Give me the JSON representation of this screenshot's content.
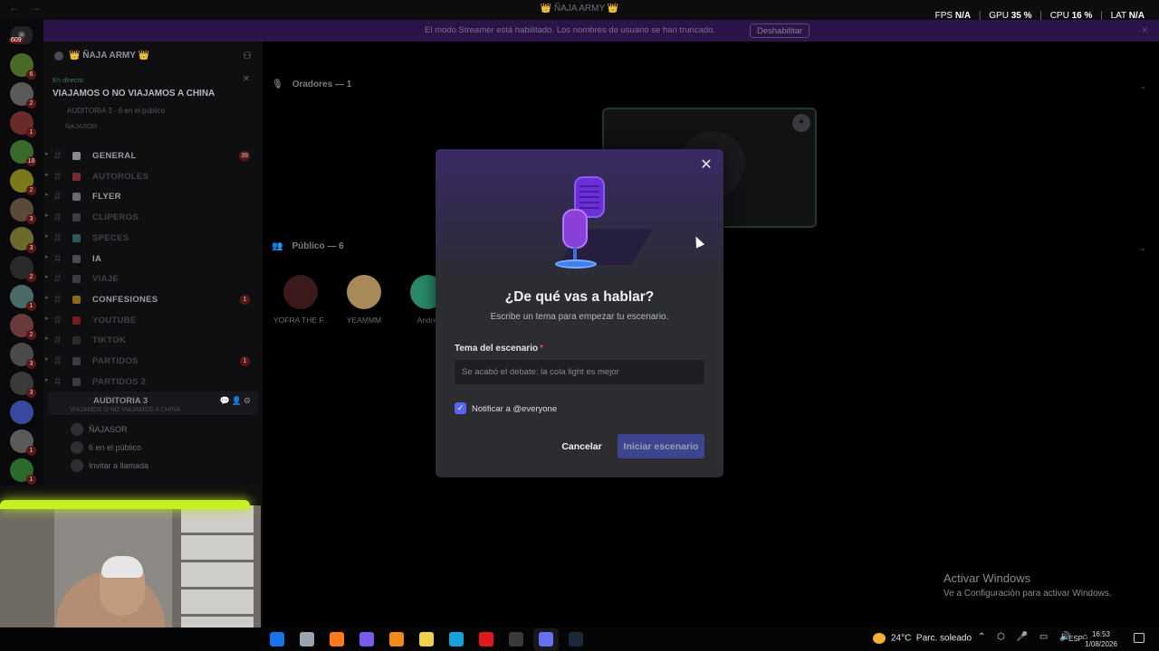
{
  "titlebar": {
    "nav_back": "←",
    "nav_forward": "→",
    "title": "👑 ÑAJA ARMY 👑",
    "stats": {
      "fps_label": "FPS",
      "fps_value": "N/A",
      "gpu_label": "GPU",
      "gpu_value": "35 %",
      "cpu_label": "CPU",
      "cpu_value": "16 %",
      "lat_label": "LAT",
      "lat_value": "N/A"
    }
  },
  "banner": {
    "message": "El modo Streamer está habilitado. Los nombres de usuario se han truncado.",
    "button": "Deshabilitar",
    "close": "×"
  },
  "rail": {
    "count": "609",
    "servers": [
      {
        "badge": "6",
        "color": "#4a6a2a"
      },
      {
        "badge": "2",
        "color": "#5a5a5a"
      },
      {
        "badge": "1",
        "color": "#6a2a2a"
      },
      {
        "badge": "18",
        "color": "#3a6a2a"
      },
      {
        "badge": "2",
        "color": "#7a7a1a"
      },
      {
        "badge": "3",
        "color": "#5a4a3a"
      },
      {
        "badge": "3",
        "color": "#6a6a2a"
      },
      {
        "badge": "2",
        "color": "#2a2a2a"
      },
      {
        "badge": "1",
        "color": "#4a6a6a"
      },
      {
        "badge": "2",
        "color": "#6a3a3a"
      },
      {
        "badge": "3",
        "color": "#4a4a4a"
      },
      {
        "badge": "3",
        "color": "#3a3a3a"
      },
      {
        "badge": "",
        "color": "#3a4aa0"
      },
      {
        "badge": "1",
        "color": "#5a5a5a"
      },
      {
        "badge": "1",
        "color": "#2a6a2a"
      }
    ]
  },
  "sidebar": {
    "server_name": "👑 ÑAJA ARMY 👑",
    "live_tag": "En directo",
    "live_title": "VIAJAMOS O NO VIAJAMOS A CHINA",
    "live_sub": "AUDITORIA 3  ·  6 en el público",
    "live_sub2": "ÑAJASOR",
    "channels": [
      {
        "label": "GENERAL",
        "badge": "39",
        "bright": true,
        "color": "#8a8c91"
      },
      {
        "label": "AUTOROLES",
        "badge": "",
        "bright": false,
        "color": "#7a2a2a"
      },
      {
        "label": "FLYER",
        "badge": "",
        "bright": true,
        "color": "#6a6c72"
      },
      {
        "label": "CLIPEROS",
        "badge": "",
        "bright": false,
        "color": "#3a3c42"
      },
      {
        "label": "SPECES",
        "badge": "",
        "bright": false,
        "color": "#2a5a5a"
      },
      {
        "label": "IA",
        "badge": "",
        "bright": true,
        "color": "#4a4c52"
      },
      {
        "label": "VIAJE",
        "badge": "",
        "bright": false,
        "color": "#3a3c42"
      },
      {
        "label": "CONFESIONES",
        "badge": "1",
        "bright": true,
        "color": "#8a6a1a"
      },
      {
        "label": "YOUTUBE",
        "badge": "",
        "bright": false,
        "color": "#7a1a1a"
      },
      {
        "label": "TIKTOK",
        "badge": "",
        "bright": false,
        "color": "#2a2a2a"
      },
      {
        "label": "PARTIDOS",
        "badge": "1",
        "bright": false,
        "color": "#3a3c42"
      },
      {
        "label": "PARTIDOS 2",
        "badge": "",
        "bright": false,
        "color": "#3a3c42"
      }
    ],
    "voice": {
      "label": "AUDITORIA 3",
      "sub": "VIAJAMOS O NO VIAJAMOS A CHINA",
      "icons": "💬👤⚙"
    },
    "voice_members": [
      {
        "label": "ÑAJASOR"
      },
      {
        "label": "6 en el público"
      },
      {
        "label": "Invitar a llamada"
      }
    ]
  },
  "stage": {
    "speakers_title": "Oradores — 1",
    "audience_title": "Público — 6",
    "audience": [
      {
        "name": "YOFRA THE F...",
        "color": "#3a1a1a"
      },
      {
        "name": "YEAMMM",
        "color": "#a88a5a"
      },
      {
        "name": "Andre",
        "color": "#2a8a6a"
      }
    ],
    "watermark_title": "Activar Windows",
    "watermark_sub": "Ve a Configuración para activar Windows."
  },
  "modal": {
    "close": "✕",
    "heading": "¿De qué vas a hablar?",
    "subheading": "Escribe un tema para empezar tu escenario.",
    "field_label": "Tema del escenario",
    "field_required": "*",
    "field_value": "",
    "field_placeholder": "Se acabó el debate: la cola light es mejor",
    "checkbox_checked": true,
    "checkbox_label": "Notificar a @everyone",
    "cancel": "Cancelar",
    "start": "Iniciar escenario"
  },
  "taskbar": {
    "apps": [
      {
        "name": "outlook",
        "color": "#1a73e8",
        "active": false
      },
      {
        "name": "files",
        "color": "#9aa3b0",
        "active": false
      },
      {
        "name": "firefox",
        "color": "#ff7a1a",
        "active": false
      },
      {
        "name": "copilot",
        "color": "#7a5af0",
        "active": false
      },
      {
        "name": "vlc",
        "color": "#f08a1a",
        "active": false
      },
      {
        "name": "store",
        "color": "#f0d24a",
        "active": false
      },
      {
        "name": "edge",
        "color": "#1aa0d8",
        "active": false
      },
      {
        "name": "opera",
        "color": "#e01a1a",
        "active": false
      },
      {
        "name": "obs",
        "color": "#3a3a3a",
        "active": false
      },
      {
        "name": "discord",
        "color": "#5865f2",
        "active": true
      },
      {
        "name": "steam",
        "color": "#1b2838",
        "active": false
      }
    ],
    "weather_temp": "24°C",
    "weather_desc": "Parc. soleado",
    "tray": "⌃ ⬡ 🎤 ▭ 🔊 ⌂",
    "lang": "ESP",
    "time": "16:53",
    "date": "1/08/2026"
  }
}
